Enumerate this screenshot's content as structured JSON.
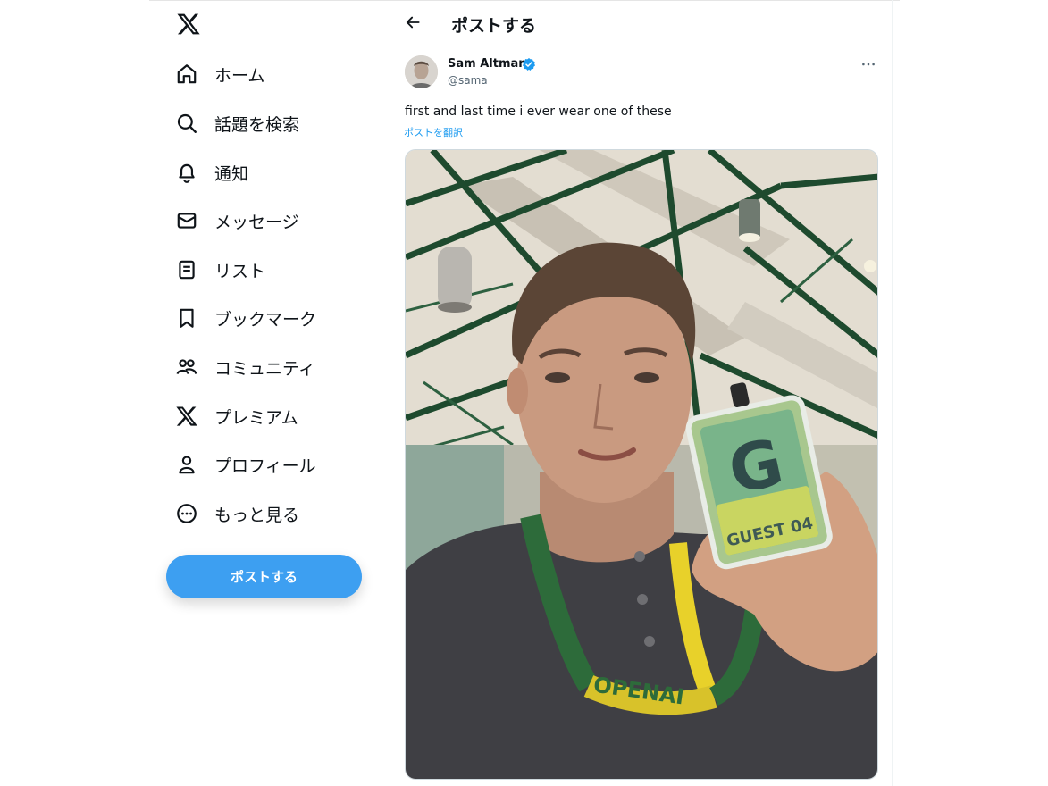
{
  "sidebar": {
    "items": [
      {
        "label": "ホーム",
        "icon": "home-icon"
      },
      {
        "label": "話題を検索",
        "icon": "search-icon"
      },
      {
        "label": "通知",
        "icon": "bell-icon"
      },
      {
        "label": "メッセージ",
        "icon": "mail-icon"
      },
      {
        "label": "リスト",
        "icon": "list-icon"
      },
      {
        "label": "ブックマーク",
        "icon": "bookmark-icon"
      },
      {
        "label": "コミュニティ",
        "icon": "communities-icon"
      },
      {
        "label": "プレミアム",
        "icon": "x-premium-icon"
      },
      {
        "label": "プロフィール",
        "icon": "profile-icon"
      },
      {
        "label": "もっと見る",
        "icon": "more-circle-icon"
      }
    ],
    "post_button": "ポストする"
  },
  "header": {
    "title": "ポストする"
  },
  "tweet": {
    "display_name": "Sam Altman",
    "handle": "@sama",
    "text": "first and last time i ever wear one of these",
    "translate_link": "ポストを翻訳",
    "badge_text": "GUEST 04",
    "badge_letter": "G",
    "lanyard_text": "OPENAI"
  },
  "colors": {
    "accent": "#1d9bf0",
    "post_button": "#3d9ff1",
    "verified": "#1d9bf0"
  }
}
